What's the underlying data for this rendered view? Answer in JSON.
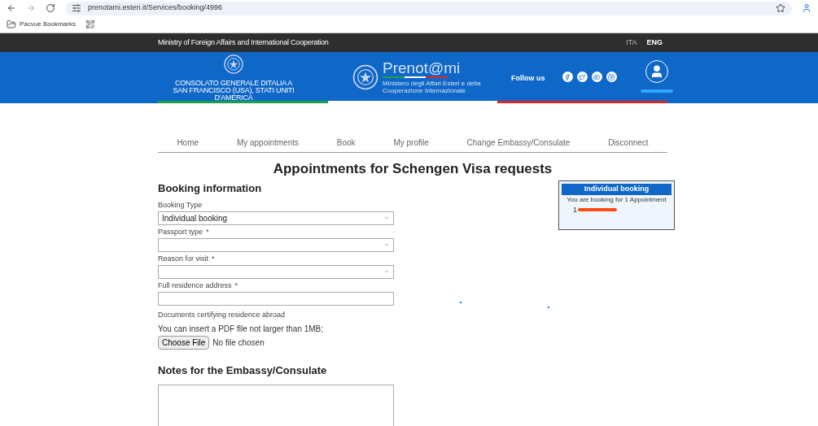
{
  "browser": {
    "url": "prenotami.esteri.it/Services/booking/4996",
    "bookmarks": [
      {
        "label": "Pacvue Bookmarks"
      }
    ]
  },
  "top_bar": {
    "title": "Ministry of Foreign Affairs and International Cooperation",
    "languages": [
      {
        "label": "ITA",
        "selected": false
      },
      {
        "label": "ENG",
        "selected": true
      }
    ]
  },
  "header": {
    "consulate": "CONSOLATO GENERALE DITALIA A SAN FRANCISCO (USA), STATI UNITI D'AMERICA",
    "logo": {
      "name": "Prenot@mi",
      "subtitle": "Ministero degli Affari Esteri e della Cooperazione Internazionale"
    },
    "follow_label": "Follow us"
  },
  "nav": [
    {
      "label": "Home"
    },
    {
      "label": "My appointments"
    },
    {
      "label": "Book"
    },
    {
      "label": "My profile"
    },
    {
      "label": "Change Embassy/Consulate"
    },
    {
      "label": "Disconnect"
    }
  ],
  "page_title": "Appointments for Schengen Visa requests",
  "booking": {
    "heading": "Booking information",
    "fields": [
      {
        "kind": "select",
        "label": "Booking Type",
        "value": "Individual booking"
      },
      {
        "kind": "select",
        "label": "Passport type",
        "marker": "*"
      },
      {
        "kind": "select",
        "label": "Reason for visit",
        "marker": "*"
      },
      {
        "kind": "text",
        "label": "Full residence address",
        "marker": "*"
      }
    ],
    "documents": {
      "label": "Documents certifying residence abroad",
      "hint": "You can insert a PDF file not larger than 1MB;",
      "button": "Choose File",
      "status": "No file chosen"
    },
    "notes_heading": "Notes for the Embassy/Consulate"
  },
  "summary": {
    "title": "Individual booking",
    "text": "You are booking for 1 Appointment",
    "item": "1"
  }
}
